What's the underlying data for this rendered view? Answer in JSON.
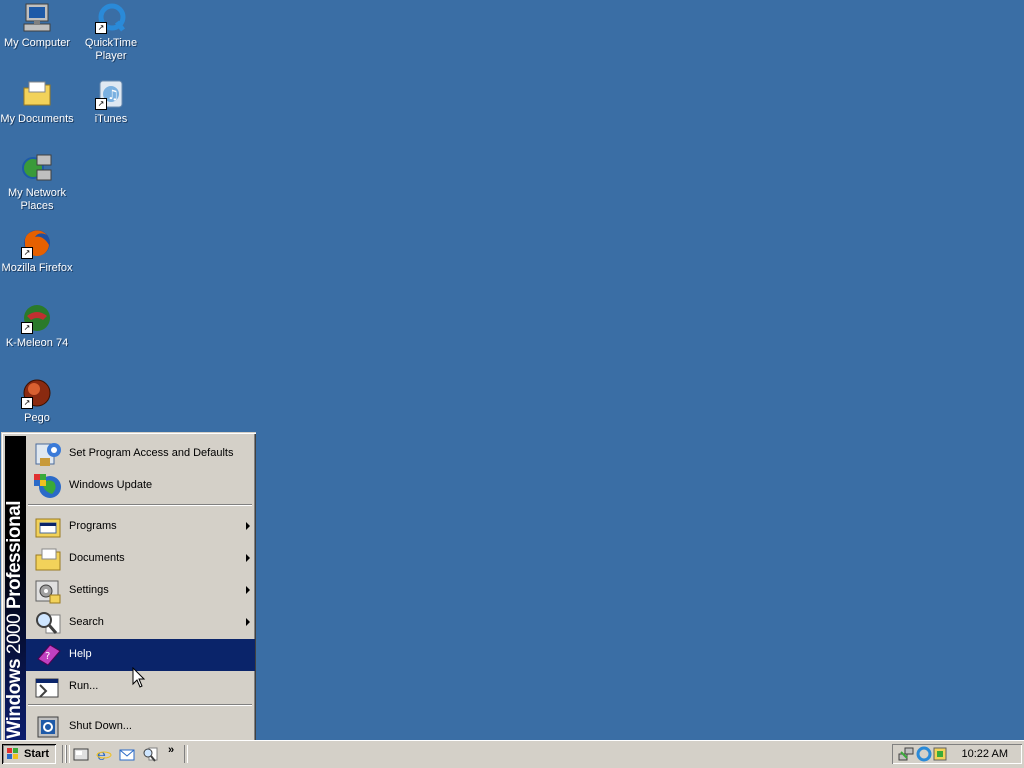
{
  "desktop": {
    "icons": [
      {
        "label": "My Computer",
        "icon": "computer-icon"
      },
      {
        "label": "QuickTime Player",
        "icon": "quicktime-icon"
      },
      {
        "label": "My Documents",
        "icon": "folder-icon"
      },
      {
        "label": "iTunes",
        "icon": "itunes-icon"
      },
      {
        "label": "My Network Places",
        "icon": "network-icon"
      },
      {
        "label": "Mozilla Firefox",
        "icon": "firefox-icon"
      },
      {
        "label": "K-Meleon 74",
        "icon": "kmeleon-icon"
      },
      {
        "label": "Pego",
        "icon": "pego-icon"
      }
    ],
    "background_color": "#3a6ea5"
  },
  "start_menu": {
    "banner": {
      "bold": "Windows",
      "thin": "2000",
      "bold2": "Professional"
    },
    "items": [
      {
        "label": "Set Program Access and Defaults",
        "icon": "program-access-icon",
        "submenu": false
      },
      {
        "label": "Windows Update",
        "icon": "windows-update-icon",
        "submenu": false
      },
      {
        "label": "Programs",
        "icon": "programs-icon",
        "submenu": true
      },
      {
        "label": "Documents",
        "icon": "documents-icon",
        "submenu": true
      },
      {
        "label": "Settings",
        "icon": "settings-icon",
        "submenu": true
      },
      {
        "label": "Search",
        "icon": "search-icon",
        "submenu": true
      },
      {
        "label": "Help",
        "icon": "help-icon",
        "submenu": false,
        "highlighted": true
      },
      {
        "label": "Run...",
        "icon": "run-icon",
        "submenu": false
      },
      {
        "label": "Shut Down...",
        "icon": "shutdown-icon",
        "submenu": false
      }
    ],
    "highlight_color": "#0a246a"
  },
  "taskbar": {
    "start_label": "Start",
    "quick_launch": [
      "show-desktop-icon",
      "internet-explorer-icon",
      "outlook-express-icon",
      "search-icon"
    ],
    "overflow": "»",
    "tray": {
      "icons": [
        "network-tray-icon",
        "quicktime-tray-icon",
        "tray-app-icon"
      ],
      "clock": "10:22 AM"
    }
  }
}
